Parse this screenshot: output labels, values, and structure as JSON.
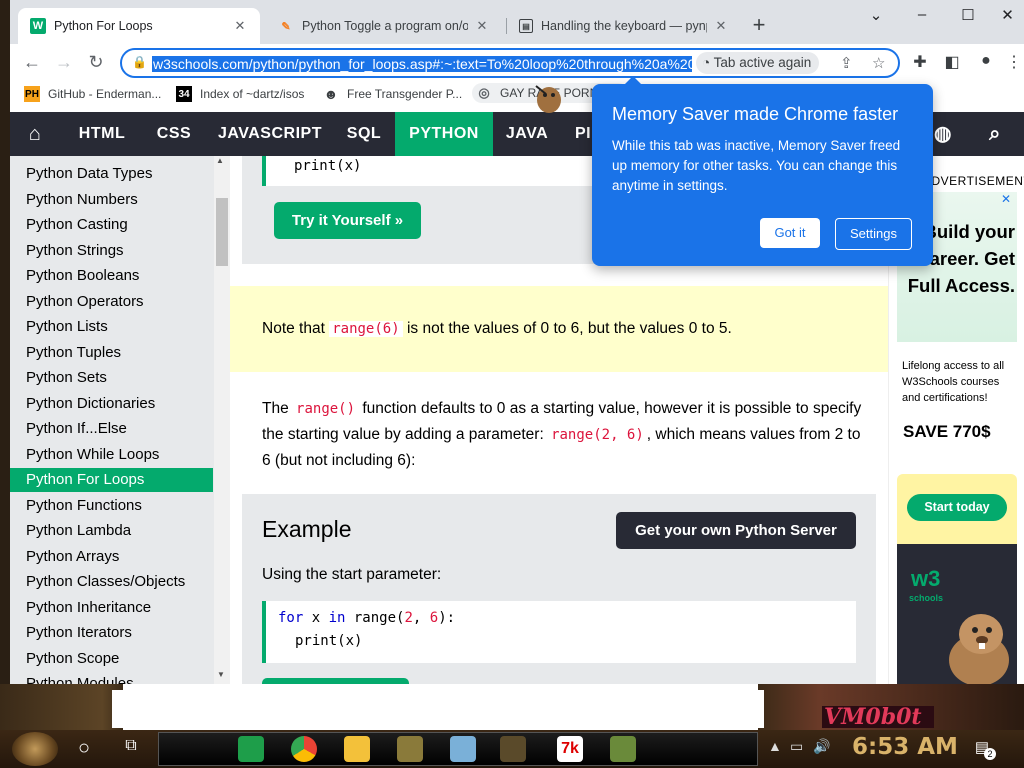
{
  "browser": {
    "tabs": [
      {
        "title": "Python For Loops",
        "active": true,
        "icon": "w3schools-icon"
      },
      {
        "title": "Python Toggle a program on/off",
        "active": false,
        "icon": "edit-icon"
      },
      {
        "title": "Handling the keyboard — pynput",
        "active": false,
        "icon": "doc-icon"
      }
    ],
    "new_tab_symbol": "+",
    "window_controls": {
      "minimize": "⌄",
      "min": "–",
      "max": "☐",
      "close": "✕"
    },
    "url": "w3schools.com/python/python_for_loops.asp#:~:text=To%20loop%20through%20a%20",
    "tab_active_chip": "Tab active again",
    "bookmarks": [
      {
        "label": "GitHub - Enderman...",
        "icon": "ph-icon"
      },
      {
        "label": "Index of ~dartz/isos",
        "icon": "dartz-icon"
      },
      {
        "label": "Free Transgender P...",
        "icon": "person-icon"
      },
      {
        "label": "GAY RAPE PORN X...",
        "icon": "globe-icon"
      }
    ]
  },
  "popup": {
    "title": "Memory Saver made Chrome faster",
    "body": "While this tab was inactive, Memory Saver freed up memory for other tasks. You can change this anytime in settings.",
    "got_it": "Got it",
    "settings": "Settings"
  },
  "topnav": {
    "items": [
      "HTML",
      "CSS",
      "JAVASCRIPT",
      "SQL",
      "PYTHON",
      "JAVA",
      "PI"
    ],
    "active": "PYTHON"
  },
  "sidebar": {
    "items": [
      "Python Data Types",
      "Python Numbers",
      "Python Casting",
      "Python Strings",
      "Python Booleans",
      "Python Operators",
      "Python Lists",
      "Python Tuples",
      "Python Sets",
      "Python Dictionaries",
      "Python If...Else",
      "Python While Loops",
      "Python For Loops",
      "Python Functions",
      "Python Lambda",
      "Python Arrays",
      "Python Classes/Objects",
      "Python Inheritance",
      "Python Iterators",
      "Python Scope",
      "Python Modules"
    ],
    "active_index": 12
  },
  "content": {
    "top_code": "print(x)",
    "try_button": "Try it Yourself »",
    "note_before": "Note that",
    "note_code": "range(6)",
    "note_after": "is not the values of 0 to 6, but the values 0 to 5.",
    "para_1": "The",
    "para_code1": "range()",
    "para_2": "function defaults to 0 as a starting value, however it is possible to specify the starting value by adding a parameter:",
    "para_code2": "range(2, 6)",
    "para_3": ", which means values from 2 to 6 (but not including 6):",
    "example_title": "Example",
    "server_button": "Get your own Python Server",
    "example_sub": "Using the start parameter:",
    "code_line1_kw1": "for",
    "code_line1_mid": " x ",
    "code_line1_kw2": "in",
    "code_line1_fn": " range(",
    "code_line1_n1": "2",
    "code_line1_sep": ", ",
    "code_line1_n2": "6",
    "code_line1_end": "):",
    "code_line2": "print(x)"
  },
  "ad": {
    "label": "ADVERTISEMENT",
    "headline": "Build your career. Get Full Access.",
    "close": "✕",
    "lifelong": "Lifelong access to all W3Schools courses and certifications!",
    "save": "SAVE 770$",
    "start": "Start today",
    "logo": "w3",
    "logo_sub": "schools"
  },
  "taskbar": {
    "time": "6:53 AM",
    "notification_count": "2",
    "wallpaper_text": "VM0b0t"
  },
  "colors": {
    "w3_green": "#04aa6d",
    "nav_dark": "#282a35",
    "chrome_blue": "#1a73e8",
    "note_yellow": "#ffffcc"
  }
}
